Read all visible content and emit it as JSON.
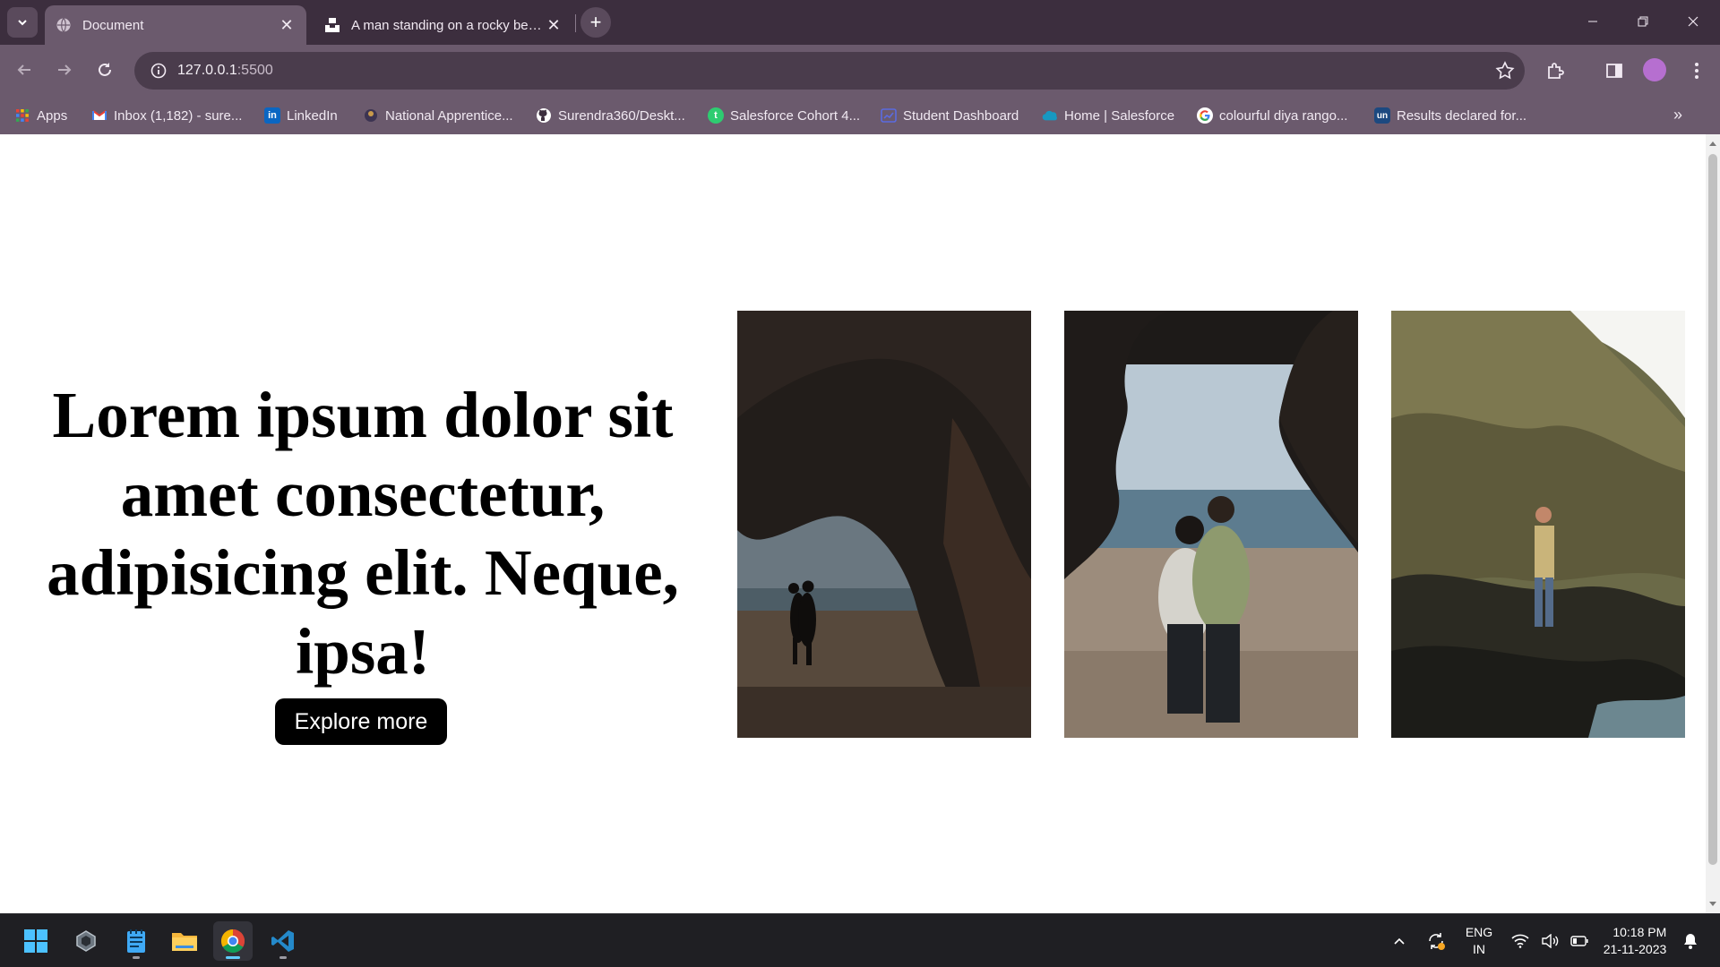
{
  "browser": {
    "tabs": [
      {
        "title": "Document",
        "active": true,
        "icon": "globe-icon"
      },
      {
        "title": "A man standing on a rocky beach",
        "active": false,
        "icon": "unsplash-icon"
      }
    ],
    "address": {
      "host": "127.0.0.1",
      "port": ":5500"
    },
    "bookmarks": [
      {
        "label": "Apps",
        "icon": "apps-grid-icon",
        "color": "#f4b400"
      },
      {
        "label": "Inbox (1,182) - sure...",
        "icon": "gmail-icon",
        "color": "#ea4335"
      },
      {
        "label": "LinkedIn",
        "icon": "linkedin-icon",
        "color": "#0a66c2"
      },
      {
        "label": "National Apprentice...",
        "icon": "emblem-icon",
        "color": "#8a6d3b"
      },
      {
        "label": "Surendra360/Deskt...",
        "icon": "github-icon",
        "color": "#ffffff"
      },
      {
        "label": "Salesforce Cohort 4...",
        "icon": "trailhead-icon",
        "color": "#2ecc71"
      },
      {
        "label": "Student Dashboard",
        "icon": "dashboard-icon",
        "color": "#5b6be0"
      },
      {
        "label": "Home | Salesforce",
        "icon": "salesforce-cloud-icon",
        "color": "#1798c1"
      },
      {
        "label": "colourful diya rango...",
        "icon": "google-icon",
        "color": "#4285f4"
      },
      {
        "label": "Results declared for...",
        "icon": "unstop-icon",
        "color": "#1c4980"
      }
    ]
  },
  "page": {
    "heading": "Lorem ipsum dolor sit amet consectetur, adipisicing elit. Neque, ipsa!",
    "button_label": "Explore more"
  },
  "taskbar": {
    "apps": [
      {
        "name": "start",
        "icon": "windows-start-icon"
      },
      {
        "name": "app",
        "icon": "hexagon-app-icon"
      },
      {
        "name": "notepad",
        "icon": "notepad-icon"
      },
      {
        "name": "file-explorer",
        "icon": "folder-icon"
      },
      {
        "name": "chrome",
        "icon": "chrome-icon"
      },
      {
        "name": "vscode",
        "icon": "vscode-icon"
      }
    ],
    "language": {
      "line1": "ENG",
      "line2": "IN"
    },
    "clock": {
      "time": "10:18 PM",
      "date": "21-11-2023"
    }
  }
}
